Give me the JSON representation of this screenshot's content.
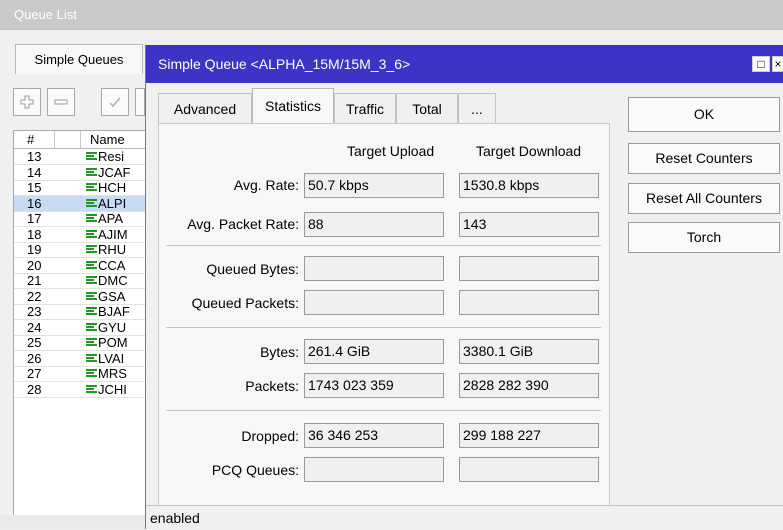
{
  "queue_list": {
    "title": "Queue List",
    "tab": "Simple Queues",
    "columns": {
      "num": "#",
      "name": "Name"
    },
    "rows": [
      {
        "num": "13",
        "name": "Resi"
      },
      {
        "num": "14",
        "name": "JCAF"
      },
      {
        "num": "15",
        "name": "HCH"
      },
      {
        "num": "16",
        "name": "ALPI"
      },
      {
        "num": "17",
        "name": "APA"
      },
      {
        "num": "18",
        "name": "AJIM"
      },
      {
        "num": "19",
        "name": "RHU"
      },
      {
        "num": "20",
        "name": "CCA"
      },
      {
        "num": "21",
        "name": "DMC"
      },
      {
        "num": "22",
        "name": "GSA"
      },
      {
        "num": "23",
        "name": "BJAF"
      },
      {
        "num": "24",
        "name": "GYU"
      },
      {
        "num": "25",
        "name": "POM"
      },
      {
        "num": "26",
        "name": "LVAI"
      },
      {
        "num": "27",
        "name": "MRS"
      },
      {
        "num": "28",
        "name": "JCHI"
      }
    ],
    "selected_num": "16",
    "toolbar": {
      "add_icon": "plus-icon",
      "remove_icon": "minus-icon",
      "enable_icon": "check-icon"
    }
  },
  "dialog": {
    "title": "Simple Queue <ALPHA_15M/15M_3_6>",
    "tabs": [
      "Advanced",
      "Statistics",
      "Traffic",
      "Total",
      "..."
    ],
    "active_tab": "Statistics",
    "col_upload": "Target Upload",
    "col_download": "Target Download",
    "stats": {
      "avg_rate": {
        "label": "Avg. Rate:",
        "upload": "50.7 kbps",
        "download": "1530.8 kbps"
      },
      "avg_packet_rate": {
        "label": "Avg. Packet Rate:",
        "upload": "88",
        "download": "143"
      },
      "queued_bytes": {
        "label": "Queued Bytes:",
        "upload": "",
        "download": ""
      },
      "queued_packets": {
        "label": "Queued Packets:",
        "upload": "",
        "download": ""
      },
      "bytes": {
        "label": "Bytes:",
        "upload": "261.4 GiB",
        "download": "3380.1 GiB"
      },
      "packets": {
        "label": "Packets:",
        "upload": "1743 023 359",
        "download": "2828 282 390"
      },
      "dropped": {
        "label": "Dropped:",
        "upload": "36 346 253",
        "download": "299 188 227"
      },
      "pcq_queues": {
        "label": "PCQ Queues:",
        "upload": "",
        "download": ""
      }
    },
    "buttons": {
      "ok": "OK",
      "reset_counters": "Reset Counters",
      "reset_all_counters": "Reset All Counters",
      "torch": "Torch"
    },
    "status": "enabled"
  },
  "colors": {
    "title_bar": "#3b34c7",
    "selection": "#c7dcf4",
    "queue_icon": "#1e9a1e"
  }
}
